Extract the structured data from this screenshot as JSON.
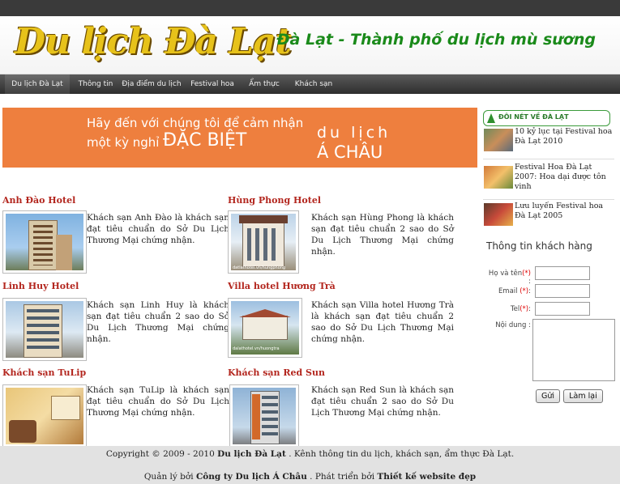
{
  "header": {
    "logo": "Du lịch Đà Lạt",
    "slogan": "Đà Lạt - Thành phố du lịch mù sương"
  },
  "nav": {
    "items": [
      "Du lịch Đà Lạt",
      "Thông tin",
      "Địa điểm du lịch",
      "Festival hoa",
      "Ẩm thực",
      "Khách sạn"
    ]
  },
  "banner": {
    "line1": "Hãy đến với chúng tôi để cảm nhận",
    "line2a": "một kỳ nghỉ",
    "line2b": "ĐẶC BIỆT",
    "right1": "du lịch",
    "right2": "Á CHÂU"
  },
  "hotels": [
    {
      "name": "Anh Đào Hotel",
      "desc": "Khách sạn Anh Đào là khách sạn đạt tiêu chuẩn do Sở Du Lịch Thương Mại chứng nhận."
    },
    {
      "name": "Hùng Phong Hotel",
      "desc": "Khách sạn Hùng Phong là khách sạn đạt tiêu chuẩn 2 sao do Sở Du Lịch Thương Mại chứng nhận.",
      "caption": "datlathotel.vn/hungphong"
    },
    {
      "name": "Linh Huy Hotel",
      "desc": "Khách sạn Linh Huy là khách sạn đạt tiêu chuẩn 2 sao do Sở Du Lịch Thương Mại chứng nhận."
    },
    {
      "name": "Villa hotel Hương Trà",
      "desc": "Khách sạn Villa hotel Hương Trà là khách sạn đạt tiêu chuẩn 2 sao do Sở Du Lịch Thương Mại chứng nhận.",
      "caption": "dalathotel.vn/huongtra"
    },
    {
      "name": "Khách sạn TuLip",
      "desc": "Khách sạn TuLip là khách sạn đạt tiêu chuẩn do Sở Du Lịch Thương Mại chứng nhận."
    },
    {
      "name": "Khách sạn Red Sun",
      "desc": "Khách sạn Red Sun là khách sạn đạt tiêu chuẩn 2 sao do Sở Du Lịch Thương Mại chứng nhận."
    }
  ],
  "sidebar": {
    "title": "ĐÔI NÉT VỀ ĐÀ LẠT",
    "news": [
      "10 kỷ lục tại Festival hoa Đà Lạt 2010",
      "Festival Hoa Đà Lạt 2007: Hoa dại được tôn vinh",
      "Lưu luyến Festival hoa Đà Lạt 2005"
    ]
  },
  "form": {
    "title": "Thông tin khách hàng",
    "name_label": "Họ và tên",
    "email_label": "Email",
    "phone_label": "Tel",
    "content_label": "Nội dung :",
    "required_mark": "(*)",
    "colon": ":",
    "submit": "Gửi",
    "reset": "Làm lại"
  },
  "footer": {
    "line1_prefix": "Copyright © 2009 - 2010",
    "line1_brand": "Du lịch Đà Lạt",
    "line1_suffix": ". Kênh thông tin du lịch, khách sạn, ẩm thực Đà Lạt.",
    "line2_prefix": "Quản lý bởi",
    "line2_company": "Công ty Du lịch Á Châu",
    "line2_middle": ". Phát triển bởi",
    "line2_dev": "Thiết kế website đẹp"
  }
}
